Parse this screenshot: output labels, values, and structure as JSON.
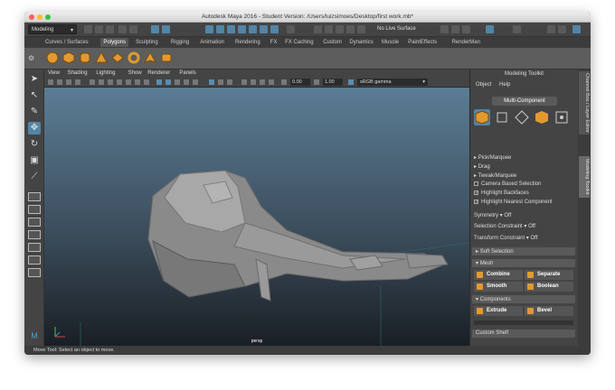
{
  "window": {
    "title": "Autodesk Maya 2016 - Student Version: /Users/luizsimoes/Desktop/first work.mb*"
  },
  "status_line": {
    "mode": "Modeling",
    "live_surface": "No Live Surface"
  },
  "shelf_tabs": [
    "Curves / Surfaces",
    "Polygons",
    "Sculpting",
    "Rigging",
    "Animation",
    "Rendering",
    "FX",
    "FX Caching",
    "Custom",
    "Dynamics",
    "Muscle",
    "PaintEffects",
    "RenderMan"
  ],
  "active_shelf": "Polygons",
  "viewport": {
    "menu": [
      "View",
      "Shading",
      "Lighting",
      "Show",
      "Renderer",
      "Panels"
    ],
    "field_a": "0.00",
    "field_b": "1.00",
    "color_space": "sRGB gamma",
    "camera": "persp"
  },
  "modeling_toolkit": {
    "title": "Modeling Toolkit",
    "menu": [
      "Object",
      "Help"
    ],
    "mode_button": "Multi-Component",
    "pick_options": [
      "Pick/Marquee",
      "Drag",
      "Tweak/Marquee"
    ],
    "checkboxes": [
      {
        "label": "Camera Based Selection",
        "checked": false
      },
      {
        "label": "Highlight Backfaces",
        "checked": true
      },
      {
        "label": "Highlight Nearest Component",
        "checked": true
      }
    ],
    "symmetry": {
      "label": "Symmetry",
      "value": "Off"
    },
    "selection_constraint": {
      "label": "Selection Constraint",
      "value": "Off"
    },
    "transform_constraint": {
      "label": "Transform Constraint",
      "value": "Off"
    },
    "soft_selection": "Soft Selection",
    "mesh": {
      "label": "Mesh",
      "buttons": [
        "Combine",
        "Separate",
        "Smooth",
        "Boolean"
      ]
    },
    "components": {
      "label": "Components",
      "buttons": [
        "Extrude",
        "Bevel"
      ]
    },
    "custom_shelf": "Custom Shelf"
  },
  "side_tabs": [
    "Channel Box / Layer Editor",
    "Modeling Toolkit"
  ],
  "help_line": "Move Tool: Select an object to move.",
  "colors": {
    "accent": "#5285a6",
    "poly_orange": "#e09a30"
  }
}
